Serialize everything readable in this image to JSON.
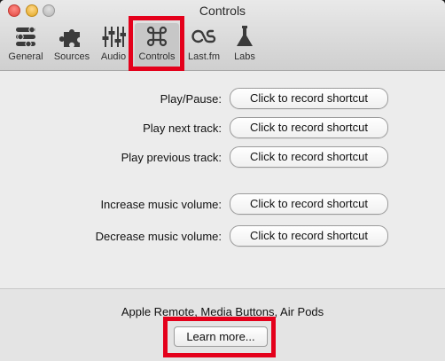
{
  "window": {
    "title": "Controls"
  },
  "toolbar": {
    "tabs": [
      {
        "label": "General",
        "icon": "general-icon"
      },
      {
        "label": "Sources",
        "icon": "puzzle-icon"
      },
      {
        "label": "Audio",
        "icon": "sliders-icon"
      },
      {
        "label": "Controls",
        "icon": "command-icon",
        "selected": true
      },
      {
        "label": "Last.fm",
        "icon": "lastfm-icon"
      },
      {
        "label": "Labs",
        "icon": "flask-icon"
      }
    ]
  },
  "shortcuts": [
    {
      "label": "Play/Pause:",
      "button": "Click to record shortcut"
    },
    {
      "label": "Play next track:",
      "button": "Click to record shortcut"
    },
    {
      "label": "Play previous track:",
      "button": "Click to record shortcut"
    },
    {
      "label": "Increase music volume:",
      "button": "Click to record shortcut"
    },
    {
      "label": "Decrease music volume:",
      "button": "Click to record shortcut"
    }
  ],
  "footer": {
    "text": "Apple Remote, Media Buttons, Air Pods",
    "learn_more": "Learn more..."
  },
  "colors": {
    "highlight": "#e4001b"
  }
}
